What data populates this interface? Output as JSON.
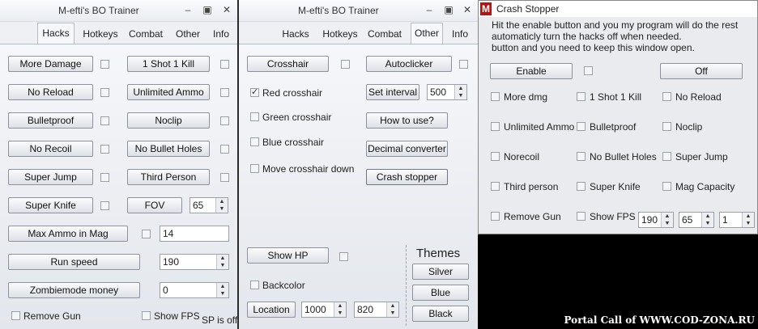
{
  "win1": {
    "title": "M-efti's BO Trainer",
    "tabs": [
      "Hacks",
      "Hotkeys",
      "Combat",
      "Other",
      "Info"
    ],
    "buttons": {
      "more_damage": "More Damage",
      "one_shot": "1 Shot 1 Kill",
      "no_reload": "No Reload",
      "unlimited_ammo": "Unlimited Ammo",
      "bulletproof": "Bulletproof",
      "noclip": "Noclip",
      "no_recoil": "No Recoil",
      "no_bullet_holes": "No Bullet Holes",
      "super_jump": "Super Jump",
      "third_person": "Third Person",
      "super_knife": "Super Knife",
      "fov": "FOV",
      "max_ammo": "Max Ammo in Mag",
      "run_speed": "Run speed",
      "zombie_money": "Zombiemode money"
    },
    "values": {
      "fov": "65",
      "max_ammo": "14",
      "run_speed": "190",
      "zombie_money": "0"
    },
    "remove_gun": "Remove Gun",
    "show_fps": "Show FPS",
    "sp_status": "SP is off"
  },
  "win2": {
    "title": "M-efti's BO Trainer",
    "tabs": [
      "Hacks",
      "Hotkeys",
      "Combat",
      "Other",
      "Info"
    ],
    "crosshair": "Crosshair",
    "red_crosshair": "Red crosshair",
    "green_crosshair": "Green crosshair",
    "blue_crosshair": "Blue crosshair",
    "move_crosshair": "Move crosshair down",
    "autoclicker": "Autoclicker",
    "set_interval": "Set interval",
    "interval_value": "500",
    "how_to_use": "How to use?",
    "decimal_converter": "Decimal converter",
    "crash_stopper": "Crash stopper",
    "show_hp": "Show HP",
    "backcolor": "Backcolor",
    "location": "Location",
    "loc_x": "1000",
    "loc_y": "820",
    "themes": {
      "title": "Themes",
      "silver": "Silver",
      "blue": "Blue",
      "black": "Black"
    }
  },
  "crash": {
    "title": "Crash Stopper",
    "logo": "M",
    "info_lines": [
      "Hit the enable button and you my program will do the rest",
      "automaticly turn the hacks off when needed.",
      "button and you need to keep this window open."
    ],
    "enable": "Enable",
    "off": "Off",
    "checks": [
      [
        "More dmg",
        "1 Shot 1 Kill",
        "No Reload"
      ],
      [
        "Unlimited Ammo",
        "Bulletproof",
        "Noclip"
      ],
      [
        "Norecoil",
        "No Bullet Holes",
        "Super Jump"
      ],
      [
        "Third person",
        "Super Knife",
        "Mag Capacity"
      ]
    ],
    "remove_gun": "Remove Gun",
    "show_fps": "Show FPS",
    "v1": "190",
    "v2": "65",
    "v3": "1"
  },
  "watermark": "Portal Call of WWW.COD-ZONA.RU"
}
